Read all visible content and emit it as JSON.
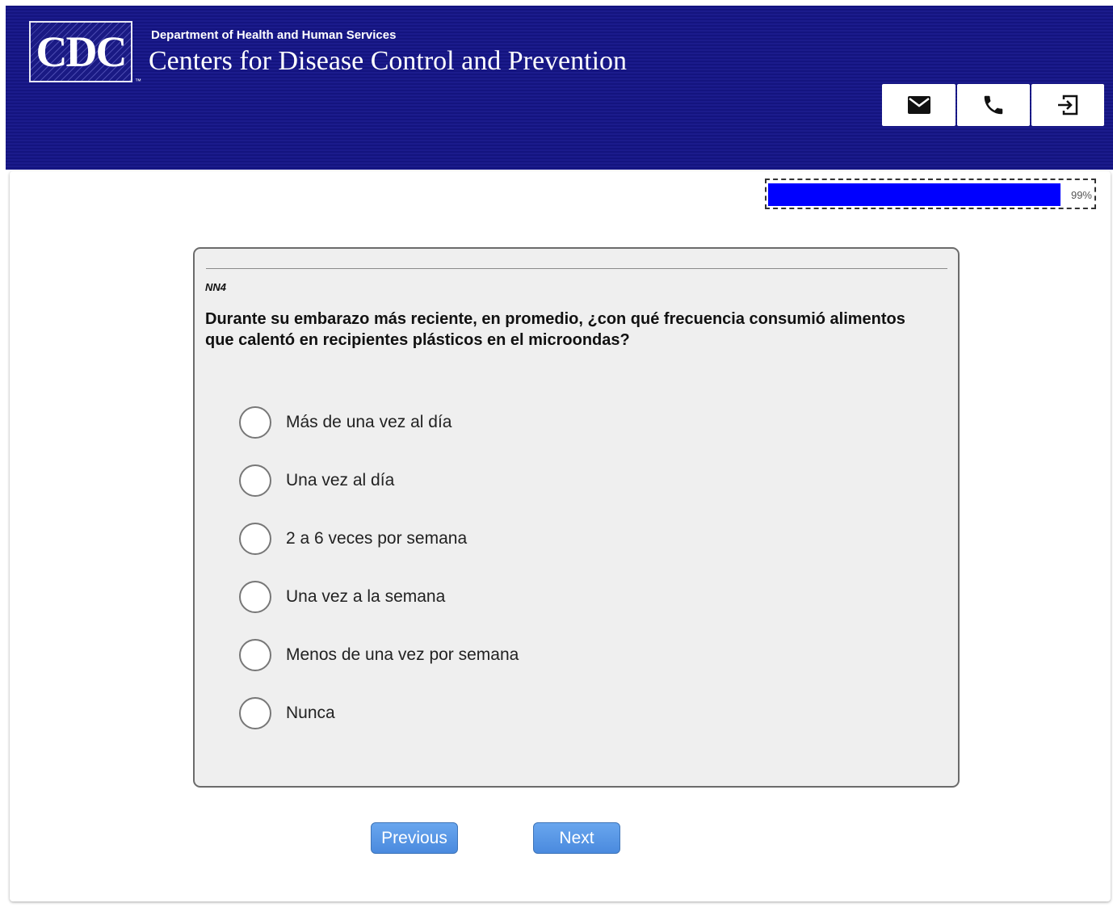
{
  "header": {
    "logo_text": "CDC",
    "logo_tm": "™",
    "department": "Department of Health and Human Services",
    "agency": "Centers for Disease Control and Prevention",
    "buttons": [
      {
        "icon": "mail-icon"
      },
      {
        "icon": "phone-icon"
      },
      {
        "icon": "exit-icon"
      }
    ]
  },
  "progress": {
    "value_percent": 99,
    "label": "99%",
    "fill_color": "#0000ff"
  },
  "question": {
    "id": "NN4",
    "text": "Durante su embarazo más reciente, en promedio, ¿con qué frecuencia consumió alimentos que calentó en recipientes plásticos en el microondas?",
    "options": [
      {
        "label": "Más de una vez al día",
        "selected": false
      },
      {
        "label": "Una vez al día",
        "selected": false
      },
      {
        "label": "2 a 6 veces por semana",
        "selected": false
      },
      {
        "label": "Una vez a la semana",
        "selected": false
      },
      {
        "label": "Menos de una vez por semana",
        "selected": false
      },
      {
        "label": "Nunca",
        "selected": false
      }
    ]
  },
  "nav": {
    "previous_label": "Previous",
    "next_label": "Next"
  },
  "colors": {
    "header_bg": "#14147f",
    "button_blue": "#4a8ade"
  }
}
